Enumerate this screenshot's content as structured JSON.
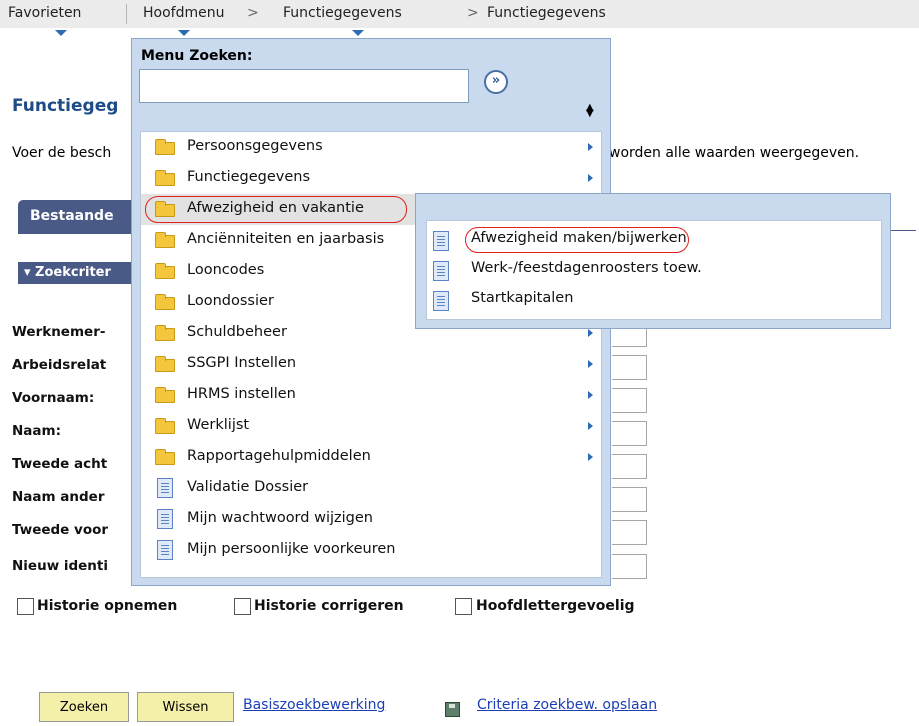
{
  "nav": {
    "favorites": "Favorieten",
    "main_menu": "Hoofdmenu",
    "sep1": ">",
    "crumb1": "Functiegegevens",
    "sep2": ">",
    "crumb2": "Functiegegevens"
  },
  "page": {
    "title": "Functiegeg",
    "description_left": "Voer de besch",
    "description_right": "worden alle waarden weergegeven.",
    "tab_existing": "Bestaande",
    "search_criteria_header": "▾ Zoekcriter",
    "fields": [
      "Werknemer-",
      "Arbeidsrelat",
      "Voornaam:",
      "Naam:",
      "Tweede acht",
      "Naam ander",
      "Tweede voor",
      "Nieuw identi"
    ],
    "checkboxes": {
      "history_include": "Historie opnemen",
      "history_correct": "Historie corrigeren",
      "case_sensitive": "Hoofdlettergevoelig"
    },
    "buttons": {
      "search": "Zoeken",
      "clear": "Wissen"
    },
    "links": {
      "basic_search": "Basiszoekbewerking",
      "save_criteria": "Criteria zoekbew. opslaan"
    }
  },
  "menu": {
    "search_label": "Menu Zoeken:",
    "search_value": "",
    "go_icon": "double-chevron-right-icon",
    "items": [
      {
        "label": "Persoonsgegevens",
        "icon": "folder-icon",
        "has_submenu": true
      },
      {
        "label": "Functiegegevens",
        "icon": "folder-icon",
        "has_submenu": true
      },
      {
        "label": "Afwezigheid en vakantie",
        "icon": "folder-icon",
        "has_submenu": true
      },
      {
        "label": "Anciënniteiten en jaarbasis",
        "icon": "folder-icon",
        "has_submenu": true
      },
      {
        "label": "Looncodes",
        "icon": "folder-icon",
        "has_submenu": true
      },
      {
        "label": "Loondossier",
        "icon": "folder-icon",
        "has_submenu": true
      },
      {
        "label": "Schuldbeheer",
        "icon": "folder-icon",
        "has_submenu": true
      },
      {
        "label": "SSGPI Instellen",
        "icon": "folder-icon",
        "has_submenu": true
      },
      {
        "label": "HRMS instellen",
        "icon": "folder-icon",
        "has_submenu": true
      },
      {
        "label": "Werklijst",
        "icon": "folder-icon",
        "has_submenu": true
      },
      {
        "label": "Rapportagehulpmiddelen",
        "icon": "folder-icon",
        "has_submenu": true
      },
      {
        "label": "Validatie Dossier",
        "icon": "document-icon",
        "has_submenu": false
      },
      {
        "label": "Mijn wachtwoord wijzigen",
        "icon": "document-icon",
        "has_submenu": false
      },
      {
        "label": "Mijn persoonlijke voorkeuren",
        "icon": "document-icon",
        "has_submenu": false
      }
    ]
  },
  "submenu": {
    "items": [
      {
        "label": "Afwezigheid maken/bijwerken",
        "icon": "document-icon"
      },
      {
        "label": "Werk-/feestdagenroosters toew.",
        "icon": "document-icon"
      },
      {
        "label": "Startkapitalen",
        "icon": "document-icon"
      }
    ]
  },
  "colors": {
    "menu_bg": "#c9d9ee",
    "tab_bg": "#4a5a86",
    "title": "#1e4c86",
    "button_bg": "#f5f0a9",
    "link": "#1c3fb5",
    "highlight_outline": "#e0201e"
  }
}
